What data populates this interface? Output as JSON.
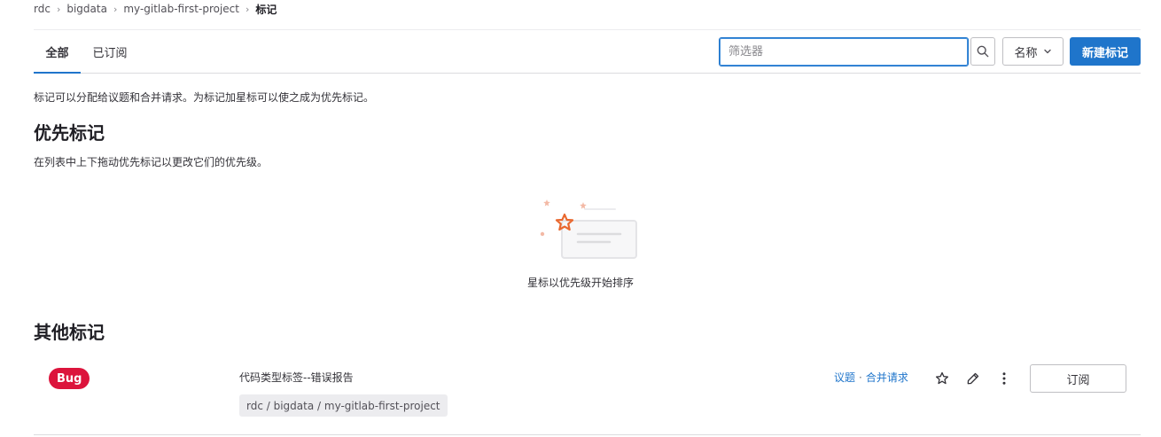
{
  "breadcrumb": {
    "items": [
      "rdc",
      "bigdata",
      "my-gitlab-first-project"
    ],
    "current": "标记"
  },
  "tabs": [
    {
      "label": "全部",
      "active": true
    },
    {
      "label": "已订阅",
      "active": false
    }
  ],
  "toolbar": {
    "filter_placeholder": "筛选器",
    "sort_label": "名称",
    "new_label": "新建标记",
    "accent_color": "#1f75cb"
  },
  "intro_text": "标记可以分配给议题和合并请求。为标记加星标可以使之成为优先标记。",
  "priority": {
    "heading": "优先标记",
    "description": "在列表中上下拖动优先标记以更改它们的优先级。",
    "empty_text": "星标以优先级开始排序"
  },
  "other": {
    "heading": "其他标记",
    "labels": [
      {
        "name": "Bug",
        "color": "#dc143c",
        "description": "代码类型标签--错误报告",
        "path": "rdc / bigdata / my-gitlab-first-project",
        "issues_link": "议题",
        "separator": "·",
        "mr_link": "合并请求",
        "subscribe_label": "订阅"
      }
    ]
  },
  "icons": {
    "search": "search-icon",
    "sort": "chevron-down-icon",
    "star": "star-icon",
    "edit": "pencil-icon",
    "more": "kebab-icon"
  }
}
